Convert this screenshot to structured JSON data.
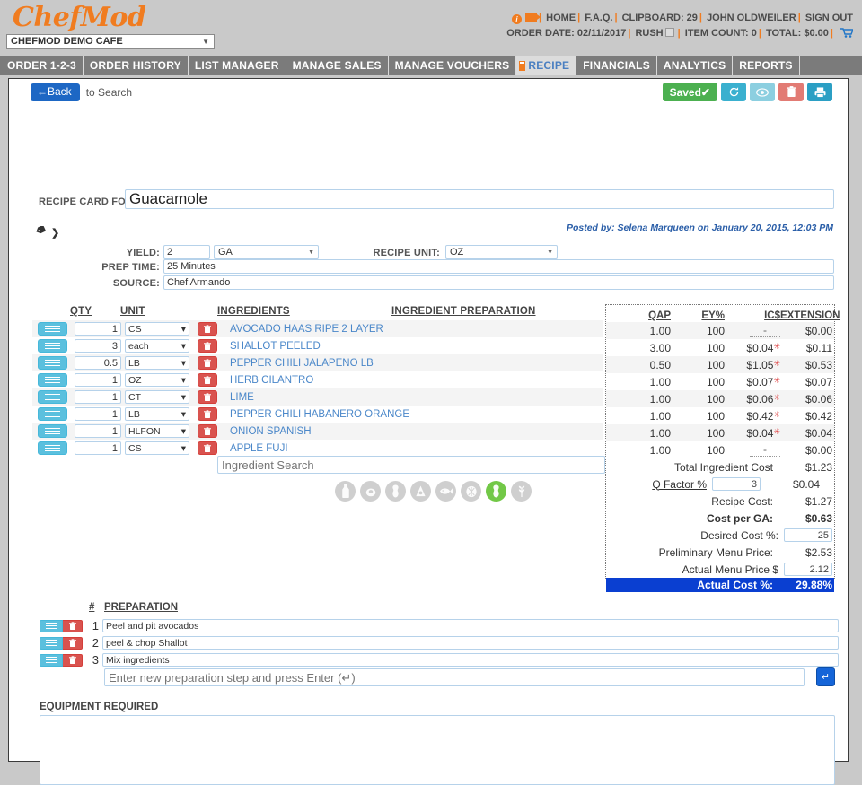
{
  "brand": {
    "logo": "ChefMod",
    "accent": "#f07c20"
  },
  "header": {
    "store": "CHEFMOD DEMO CAFE",
    "links": [
      "HOME",
      "F.A.Q."
    ],
    "clipboard_label": "CLIPBOARD: 29",
    "user": "JOHN OLDWEILER",
    "sign_out": "SIGN OUT",
    "order_date": "ORDER DATE: 02/11/2017",
    "rush_label": "RUSH",
    "item_count": "ITEM COUNT: 0",
    "total": "TOTAL: $0.00"
  },
  "nav": {
    "items": [
      {
        "label": "ORDER 1-2-3",
        "active": false
      },
      {
        "label": "ORDER HISTORY",
        "active": false
      },
      {
        "label": "LIST MANAGER",
        "active": false
      },
      {
        "label": "MANAGE SALES",
        "active": false
      },
      {
        "label": "MANAGE VOUCHERS",
        "active": false
      },
      {
        "label": "RECIPE",
        "active": true
      },
      {
        "label": "FINANCIALS",
        "active": false
      },
      {
        "label": "ANALYTICS",
        "active": false
      },
      {
        "label": "REPORTS",
        "active": false
      }
    ]
  },
  "toolbar": {
    "back_label": "←Back",
    "to_search": "to Search",
    "saved_label": "Saved✔",
    "refresh_icon": "refresh-icon",
    "view_icon": "eye-icon",
    "delete_icon": "trash-icon",
    "print_icon": "printer-icon"
  },
  "recipe": {
    "card_for_label": "RECIPE CARD FOR:",
    "name": "Guacamole",
    "posted_by": "Posted by: Selena Marqueen on January 20, 2015, 12:03 PM",
    "yield_label": "YIELD:",
    "yield_value": "2",
    "yield_unit": "GA",
    "recipe_unit_label": "RECIPE UNIT:",
    "recipe_unit": "OZ",
    "prep_time_label": "PREP TIME:",
    "prep_time": "25 Minutes",
    "source_label": "SOURCE:",
    "source": "Chef Armando"
  },
  "ingredients_table": {
    "headers": {
      "qty": "QTY",
      "unit": "UNIT",
      "ingredients": "INGREDIENTS",
      "preparation": "INGREDIENT PREPARATION"
    },
    "rows": [
      {
        "qty": "1",
        "unit": "CS",
        "name": "AVOCADO HAAS RIPE 2 LAYER",
        "prep": ""
      },
      {
        "qty": "3",
        "unit": "each",
        "name": "SHALLOT PEELED",
        "prep": ""
      },
      {
        "qty": "0.5",
        "unit": "LB",
        "name": "PEPPER CHILI JALAPENO LB",
        "prep": ""
      },
      {
        "qty": "1",
        "unit": "OZ",
        "name": "HERB CILANTRO",
        "prep": ""
      },
      {
        "qty": "1",
        "unit": "CT",
        "name": "LIME",
        "prep": ""
      },
      {
        "qty": "1",
        "unit": "LB",
        "name": "PEPPER CHILI HABANERO ORANGE",
        "prep": ""
      },
      {
        "qty": "1",
        "unit": "HLFON",
        "name": "ONION SPANISH",
        "prep": ""
      },
      {
        "qty": "1",
        "unit": "CS",
        "name": "APPLE FUJI",
        "prep": ""
      }
    ],
    "search_placeholder": "Ingredient Search"
  },
  "allergens": [
    {
      "name": "milk-allergen-icon",
      "active": false
    },
    {
      "name": "egg-allergen-icon",
      "active": false
    },
    {
      "name": "peanut-allergen-icon",
      "active": false
    },
    {
      "name": "soy-allergen-icon",
      "active": false
    },
    {
      "name": "fish-allergen-icon",
      "active": false
    },
    {
      "name": "shellfish-allergen-icon",
      "active": false
    },
    {
      "name": "treenut-allergen-icon",
      "active": true
    },
    {
      "name": "wheat-allergen-icon",
      "active": false
    }
  ],
  "cost_panel": {
    "headers": {
      "qap": "QAP",
      "ey": "EY%",
      "ics": "IC$",
      "extension": "EXTENSION"
    },
    "rows": [
      {
        "qap": "1.00",
        "ey": "100",
        "ics": "-",
        "ics_star": false,
        "ext": "$0.00"
      },
      {
        "qap": "3.00",
        "ey": "100",
        "ics": "$0.04",
        "ics_star": true,
        "ext": "$0.11"
      },
      {
        "qap": "0.50",
        "ey": "100",
        "ics": "$1.05",
        "ics_star": true,
        "ext": "$0.53"
      },
      {
        "qap": "1.00",
        "ey": "100",
        "ics": "$0.07",
        "ics_star": true,
        "ext": "$0.07"
      },
      {
        "qap": "1.00",
        "ey": "100",
        "ics": "$0.06",
        "ics_star": true,
        "ext": "$0.06"
      },
      {
        "qap": "1.00",
        "ey": "100",
        "ics": "$0.42",
        "ics_star": true,
        "ext": "$0.42"
      },
      {
        "qap": "1.00",
        "ey": "100",
        "ics": "$0.04",
        "ics_star": true,
        "ext": "$0.04"
      },
      {
        "qap": "1.00",
        "ey": "100",
        "ics": "-",
        "ics_star": false,
        "ext": "$0.00"
      }
    ],
    "summary": {
      "total_ingredient_cost_label": "Total Ingredient Cost",
      "total_ingredient_cost": "$1.23",
      "q_factor_label": "Q Factor %",
      "q_factor_value": "3",
      "q_factor_cost": "$0.04",
      "recipe_cost_label": "Recipe Cost:",
      "recipe_cost": "$1.27",
      "cost_per_label": "Cost per GA:",
      "cost_per_value": "$0.63",
      "desired_cost_label": "Desired Cost %:",
      "desired_cost_value": "25",
      "prelim_price_label": "Preliminary Menu Price:",
      "prelim_price": "$2.53",
      "actual_price_label": "Actual Menu Price $",
      "actual_price_value": "2.12",
      "actual_cost_label": "Actual Cost %:",
      "actual_cost_value": "29.88%"
    }
  },
  "preparation": {
    "num_header": "#",
    "header": "PREPARATION",
    "steps": [
      {
        "num": "1",
        "text": "Peel and pit avocados"
      },
      {
        "num": "2",
        "text": "peel & chop Shallot"
      },
      {
        "num": "3",
        "text": "Mix ingredients"
      }
    ],
    "new_placeholder": "Enter new preparation step and press Enter (↵)",
    "go_label": "↵"
  },
  "equipment": {
    "header": "EQUIPMENT REQUIRED",
    "value": ""
  }
}
